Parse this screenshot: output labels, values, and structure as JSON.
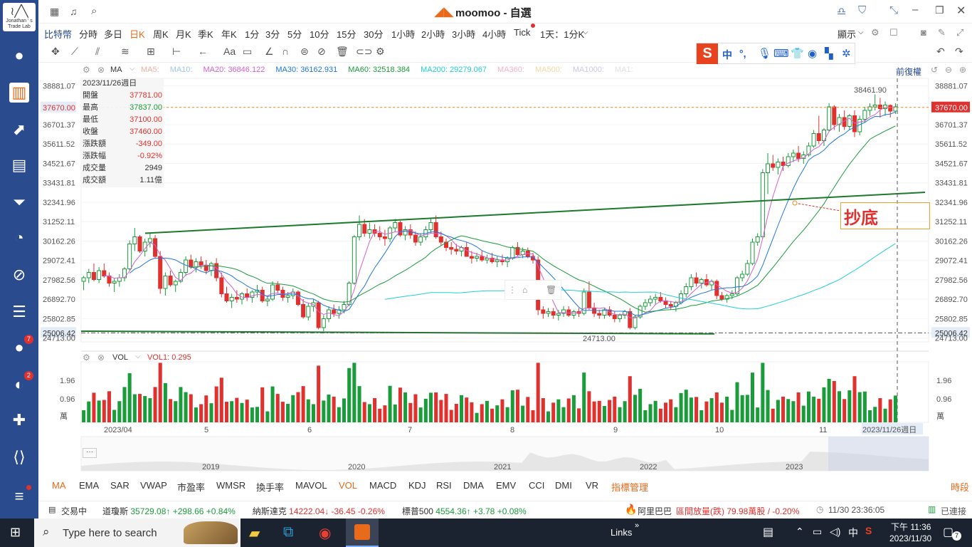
{
  "sidebar": {
    "logo_text": "Jonathan ' s Trade Lab",
    "badges": {
      "messages": "7",
      "notifications": "2"
    }
  },
  "titlebar": {
    "app_title": "moomoo - 自選"
  },
  "periods": {
    "symbol": "比特幣",
    "items": [
      "分時",
      "多日",
      "日K",
      "周K",
      "月K",
      "季K",
      "年K",
      "1分",
      "3分",
      "5分",
      "10分",
      "15分",
      "30分",
      "1小時",
      "2小時",
      "3小時",
      "4小時",
      "Tick"
    ],
    "active": "日K",
    "range_select": "1天：1分K",
    "display": "顯示"
  },
  "ma_bar": {
    "label": "MA",
    "items": [
      {
        "label": "MA5:",
        "color": "#f0b0a0"
      },
      {
        "label": "MA10:",
        "color": "#9ec7ef"
      },
      {
        "label": "MA20: 36846.122",
        "color": "#d65fd0"
      },
      {
        "label": "MA30: 36162.931",
        "color": "#1e77e0"
      },
      {
        "label": "MA60: 32518.384",
        "color": "#1a9c3b"
      },
      {
        "label": "MA200: 29279.067",
        "color": "#21cfd6"
      },
      {
        "label": "MA360:",
        "color": "#f4b3c4"
      },
      {
        "label": "MA500:",
        "color": "#f5d7a8"
      },
      {
        "label": "MA1000:",
        "color": "#cfc6ec"
      },
      {
        "label": "MA1:",
        "color": "#dfdfdf"
      }
    ],
    "adj": "前復權"
  },
  "info_box": {
    "date": "2023/11/26週日",
    "rows": [
      {
        "k": "開盤",
        "v": "37781.00",
        "c": "#e0312f"
      },
      {
        "k": "最高",
        "v": "37837.00",
        "c": "#1a9c3b"
      },
      {
        "k": "最低",
        "v": "37100.00",
        "c": "#e0312f"
      },
      {
        "k": "收盤",
        "v": "37460.00",
        "c": "#e0312f"
      },
      {
        "k": "漲跌額",
        "v": "-349.00",
        "c": "#e0312f"
      },
      {
        "k": "漲跌幅",
        "v": "-0.92%",
        "c": "#e0312f"
      },
      {
        "k": "成交量",
        "v": "2949",
        "c": "#333"
      },
      {
        "k": "成交額",
        "v": "1.11億",
        "c": "#333"
      }
    ]
  },
  "price_axis": [
    "38881.07",
    "37670.00",
    "36701.37",
    "35611.52",
    "34521.67",
    "33431.81",
    "32341.96",
    "31252.11",
    "30162.26",
    "29072.41",
    "27982.56",
    "26892.70",
    "25802.85",
    "25006.42",
    "24713.00"
  ],
  "annotations": {
    "high_label": "38461.90",
    "low_label": "24713.00",
    "current_price": "37670.00",
    "support_price": "25006.42",
    "note_text": "抄底"
  },
  "volume": {
    "label": "VOL",
    "vol1": "VOL1: 0.295",
    "axis": [
      "1.96",
      "0.96",
      "萬"
    ]
  },
  "time_axis": [
    "2023/04",
    "5",
    "6",
    "7",
    "8",
    "9",
    "10",
    "11",
    "2023/11/26週日"
  ],
  "overview_years": [
    "2019",
    "2020",
    "2021",
    "2022",
    "2023"
  ],
  "indicator_tabs": [
    "MA",
    "EMA",
    "SAR",
    "VWAP",
    "市盈率",
    "WMSR",
    "換手率",
    "MAVOL",
    "VOL",
    "MACD",
    "KDJ",
    "RSI",
    "DMA",
    "EMV",
    "CCI",
    "DMI",
    "VR",
    "指標管理"
  ],
  "indicator_right": "時段",
  "ticker": {
    "market": "交易中",
    "items": [
      {
        "name": "道瓊斯",
        "price": "35729.08",
        "chg": "+298.66",
        "pct": "+0.84%",
        "dir": "up"
      },
      {
        "name": "納斯達克",
        "price": "14222.04",
        "chg": "-36.45",
        "pct": "-0.26%",
        "dir": "down"
      },
      {
        "name": "標普500",
        "price": "4554.36",
        "chg": "+3.78",
        "pct": "+0.08%",
        "dir": "up"
      }
    ],
    "news": "阿里巴巴",
    "news_text": "區間放量(跌) 79.98萬股 / -0.20%",
    "time": "11/30 23:36:05",
    "connection": "已連接"
  },
  "ime": {
    "items": [
      "中",
      "°,"
    ]
  },
  "taskbar": {
    "search_placeholder": "Type here to search",
    "links": "Links",
    "time": "下午 11:36",
    "date": "2023/11/30",
    "lang": "中",
    "notif": "7"
  },
  "candles": [
    [
      27900,
      28200,
      27400,
      28100
    ],
    [
      28100,
      28600,
      27800,
      28400
    ],
    [
      28400,
      28900,
      27900,
      28000
    ],
    [
      28000,
      28700,
      27800,
      28500
    ],
    [
      28500,
      28900,
      28100,
      28200
    ],
    [
      28200,
      28400,
      27600,
      27800
    ],
    [
      27800,
      28100,
      27300,
      27900
    ],
    [
      27900,
      28300,
      27600,
      28100
    ],
    [
      28100,
      28700,
      27900,
      28600
    ],
    [
      28600,
      30200,
      28500,
      30000
    ],
    [
      30000,
      30900,
      29600,
      30400
    ],
    [
      30400,
      30500,
      29500,
      29600
    ],
    [
      29600,
      30300,
      29300,
      30100
    ],
    [
      30100,
      30600,
      29800,
      30300
    ],
    [
      30300,
      30500,
      29200,
      29300
    ],
    [
      29300,
      29600,
      27200,
      27500
    ],
    [
      27500,
      28400,
      27100,
      28200
    ],
    [
      28200,
      28500,
      27600,
      27700
    ],
    [
      27700,
      28000,
      27300,
      27900
    ],
    [
      27900,
      28600,
      27800,
      28400
    ],
    [
      28400,
      29300,
      28200,
      29100
    ],
    [
      29100,
      29400,
      28600,
      28700
    ],
    [
      28700,
      29200,
      28400,
      29000
    ],
    [
      29000,
      29300,
      28600,
      28800
    ],
    [
      28800,
      29100,
      28300,
      28500
    ],
    [
      28500,
      29000,
      28200,
      28900
    ],
    [
      28900,
      29200,
      27900,
      28100
    ],
    [
      28100,
      28400,
      27000,
      27200
    ],
    [
      27200,
      27600,
      26700,
      26800
    ],
    [
      26800,
      27200,
      26400,
      27000
    ],
    [
      27000,
      27400,
      26700,
      26900
    ],
    [
      26900,
      27300,
      26600,
      27200
    ],
    [
      27200,
      27500,
      26800,
      27000
    ],
    [
      27000,
      27400,
      26700,
      27300
    ],
    [
      27300,
      27700,
      27000,
      27400
    ],
    [
      27400,
      27600,
      26700,
      26800
    ],
    [
      26800,
      27100,
      26500,
      26900
    ],
    [
      26900,
      27900,
      26800,
      27700
    ],
    [
      27700,
      27900,
      27200,
      27400
    ],
    [
      27400,
      27600,
      26800,
      27000
    ],
    [
      27000,
      27300,
      26700,
      27100
    ],
    [
      27100,
      27500,
      26900,
      27300
    ],
    [
      27300,
      27400,
      26500,
      26600
    ],
    [
      26600,
      26900,
      25800,
      25900
    ],
    [
      25900,
      26700,
      25700,
      26500
    ],
    [
      26500,
      26900,
      26200,
      26700
    ],
    [
      26700,
      26800,
      25200,
      25300
    ],
    [
      25300,
      26000,
      25100,
      25800
    ],
    [
      25800,
      26500,
      25600,
      26300
    ],
    [
      26300,
      26600,
      25900,
      26100
    ],
    [
      26100,
      26500,
      25800,
      26300
    ],
    [
      26300,
      26800,
      26100,
      26600
    ],
    [
      26600,
      27900,
      26500,
      27800
    ],
    [
      27800,
      30500,
      27700,
      30400
    ],
    [
      30400,
      31600,
      30200,
      31100
    ],
    [
      31100,
      31400,
      30400,
      30600
    ],
    [
      30600,
      31200,
      30300,
      30800
    ],
    [
      30800,
      31100,
      30400,
      30600
    ],
    [
      30600,
      31000,
      30200,
      30400
    ],
    [
      30400,
      30800,
      29900,
      30300
    ],
    [
      30300,
      31000,
      30100,
      30900
    ],
    [
      30900,
      31400,
      30700,
      31200
    ],
    [
      31200,
      31300,
      30400,
      30500
    ],
    [
      30500,
      31000,
      30200,
      30800
    ],
    [
      30800,
      31100,
      30300,
      30500
    ],
    [
      30500,
      30700,
      29900,
      30100
    ],
    [
      30100,
      30600,
      29900,
      30400
    ],
    [
      30400,
      31000,
      30200,
      30800
    ],
    [
      30800,
      31400,
      30600,
      31200
    ],
    [
      31200,
      31600,
      30300,
      30400
    ],
    [
      30400,
      30700,
      29900,
      30100
    ],
    [
      30100,
      30300,
      29600,
      29800
    ],
    [
      29800,
      30100,
      29400,
      29700
    ],
    [
      29700,
      30000,
      29400,
      29600
    ],
    [
      29600,
      29900,
      29300,
      29800
    ],
    [
      29800,
      30100,
      29500,
      29300
    ],
    [
      29300,
      29600,
      28900,
      29200
    ],
    [
      29200,
      29500,
      29000,
      29300
    ],
    [
      29300,
      29600,
      29000,
      29100
    ],
    [
      29100,
      29400,
      28900,
      29200
    ],
    [
      29200,
      29500,
      28900,
      29000
    ],
    [
      29000,
      29300,
      28700,
      29100
    ],
    [
      29100,
      29400,
      28800,
      29000
    ],
    [
      29000,
      29300,
      28700,
      29200
    ],
    [
      29200,
      29900,
      29100,
      29800
    ],
    [
      29800,
      30100,
      29300,
      29400
    ],
    [
      29400,
      29800,
      29200,
      29600
    ],
    [
      29600,
      29800,
      29200,
      29300
    ],
    [
      29300,
      29500,
      28900,
      29100
    ],
    [
      29100,
      29300,
      26000,
      26300
    ],
    [
      26300,
      26500,
      25800,
      26100
    ],
    [
      26100,
      26400,
      25900,
      26200
    ],
    [
      26200,
      26400,
      25800,
      26000
    ],
    [
      26000,
      26300,
      25700,
      26100
    ],
    [
      26100,
      26500,
      25900,
      26300
    ],
    [
      26300,
      26500,
      25900,
      26000
    ],
    [
      26000,
      26300,
      25800,
      26200
    ],
    [
      26200,
      26400,
      25900,
      26100
    ],
    [
      26100,
      27500,
      26000,
      27300
    ],
    [
      27300,
      27900,
      26300,
      26400
    ],
    [
      26400,
      26700,
      25900,
      26100
    ],
    [
      26100,
      26300,
      25800,
      26000
    ],
    [
      26000,
      26400,
      25800,
      26300
    ],
    [
      26300,
      26500,
      25900,
      26000
    ],
    [
      26000,
      26200,
      25600,
      25800
    ],
    [
      25800,
      26100,
      25600,
      26000
    ],
    [
      26000,
      26300,
      25800,
      26200
    ],
    [
      26200,
      26400,
      25200,
      25300
    ],
    [
      25300,
      26000,
      25200,
      25900
    ],
    [
      25900,
      26600,
      25800,
      26500
    ],
    [
      26500,
      26900,
      26300,
      26700
    ],
    [
      26700,
      27100,
      26500,
      26900
    ],
    [
      26900,
      27200,
      26600,
      27000
    ],
    [
      27000,
      27300,
      26700,
      26800
    ],
    [
      26800,
      27000,
      26400,
      26600
    ],
    [
      26600,
      26800,
      26300,
      26500
    ],
    [
      26500,
      26800,
      26200,
      26700
    ],
    [
      26700,
      27400,
      26600,
      27200
    ],
    [
      27200,
      27800,
      27000,
      27600
    ],
    [
      27600,
      28300,
      27400,
      28100
    ],
    [
      28100,
      28400,
      27600,
      27800
    ],
    [
      27800,
      28100,
      27500,
      28000
    ],
    [
      28000,
      28300,
      27600,
      27700
    ],
    [
      27700,
      28000,
      27400,
      27900
    ],
    [
      27900,
      28000,
      26900,
      27100
    ],
    [
      27100,
      27300,
      26800,
      26900
    ],
    [
      26900,
      27200,
      26700,
      27100
    ],
    [
      27100,
      27400,
      26900,
      27200
    ],
    [
      27200,
      28200,
      27100,
      28100
    ],
    [
      28100,
      28500,
      27900,
      28300
    ],
    [
      28300,
      29100,
      28200,
      28900
    ],
    [
      28900,
      30300,
      28800,
      30100
    ],
    [
      30100,
      30600,
      29900,
      30400
    ],
    [
      30400,
      34200,
      30300,
      34000
    ],
    [
      34000,
      35100,
      32800,
      34500
    ],
    [
      34500,
      35000,
      34100,
      34300
    ],
    [
      34300,
      34800,
      33900,
      34600
    ],
    [
      34600,
      34900,
      34100,
      34400
    ],
    [
      34400,
      35100,
      34300,
      34900
    ],
    [
      34900,
      35300,
      34600,
      35100
    ],
    [
      35100,
      35500,
      34600,
      34800
    ],
    [
      34800,
      35200,
      34500,
      35000
    ],
    [
      35000,
      35700,
      34900,
      35500
    ],
    [
      35500,
      36400,
      35400,
      36200
    ],
    [
      36200,
      37200,
      35600,
      35800
    ],
    [
      35800,
      36500,
      35500,
      36400
    ],
    [
      36400,
      37900,
      36300,
      37700
    ],
    [
      37700,
      37800,
      36400,
      36700
    ],
    [
      36700,
      37300,
      36300,
      37100
    ],
    [
      37100,
      37500,
      36400,
      36600
    ],
    [
      36600,
      37300,
      36400,
      37200
    ],
    [
      37200,
      37500,
      36000,
      36300
    ],
    [
      36300,
      37200,
      36100,
      37000
    ],
    [
      37000,
      37700,
      36800,
      37500
    ],
    [
      37500,
      37900,
      37200,
      37700
    ],
    [
      37700,
      38400,
      37500,
      37800
    ],
    [
      37800,
      38200,
      37100,
      37600
    ],
    [
      37600,
      38000,
      37200,
      37800
    ],
    [
      37781,
      37837,
      37100,
      37460
    ],
    [
      37460,
      37900,
      37300,
      37700
    ]
  ]
}
